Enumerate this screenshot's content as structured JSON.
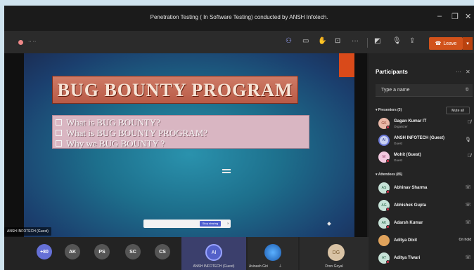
{
  "window": {
    "title": "Penetration Testing ( In Software Testing) conducted by ANSH Infotech."
  },
  "toolbar": {
    "leave_label": "Leave"
  },
  "slide": {
    "heading": "BUG BOUNTY PROGRAM",
    "bullets": [
      "What is BUG BOUNTY?",
      "What is BUG BOUNTY PROGRAM?",
      "Why we BUG BOUNTY ?"
    ]
  },
  "share_banner": {
    "button": "Stop sharing"
  },
  "stage": {
    "name_tag": "ANSH INFOTECH (Guest)"
  },
  "gallery": {
    "overflow": "+80",
    "bubbles": [
      "AK",
      "PS",
      "SC",
      "CS"
    ],
    "tiles": [
      {
        "initials": "AI",
        "name": "ANSH INFOTECH (Guest)"
      },
      {
        "initials": "",
        "name": "Avinash Giri"
      },
      {
        "initials": "DG",
        "name": "Dron Goyal"
      }
    ]
  },
  "participants": {
    "title": "Participants",
    "search_placeholder": "Type a name",
    "presenters_label": "Presenters (3)",
    "mute_all": "Mute all",
    "attendees_label": "Attendees (85)",
    "presenters": [
      {
        "initials": "GK",
        "name": "Gagan Kumar IT",
        "role": "Organizer"
      },
      {
        "initials": "AI",
        "name": "ANSH INFOTECH (Guest)",
        "role": "Guest"
      },
      {
        "initials": "M",
        "name": "Mohit (Guest)",
        "role": "Guest"
      }
    ],
    "attendees": [
      {
        "initials": "AS",
        "name": "Abhinav Sharma"
      },
      {
        "initials": "AG",
        "name": "Abhishek Gupta"
      },
      {
        "initials": "AK",
        "name": "Adarsh Kumar"
      },
      {
        "initials": "AD",
        "name": "Aditya Dixit",
        "status": "On hold"
      },
      {
        "initials": "AT",
        "name": "Aditya Tiwari"
      }
    ]
  },
  "colors": {
    "accent": "#6b78d6",
    "leave": "#d1521b",
    "banner": "#b85a46"
  }
}
